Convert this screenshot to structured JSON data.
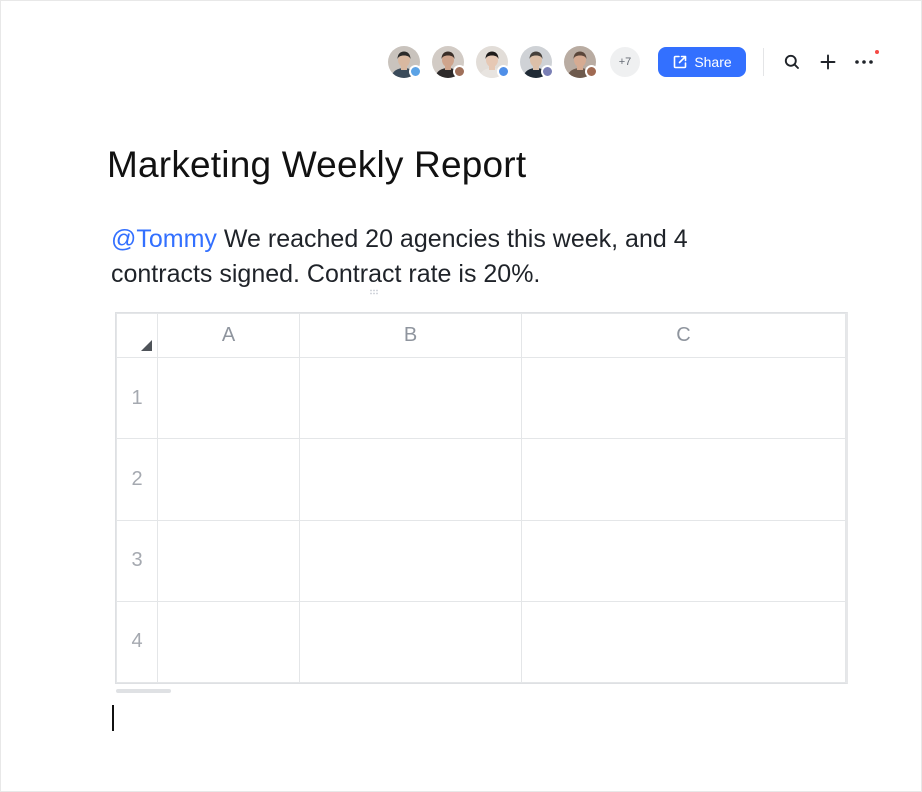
{
  "toolbar": {
    "collaborators": [
      {
        "name": "collaborator-1",
        "status_color": "#5ba3e6",
        "bg": "#c9c3bd",
        "hair": "#2a2a2a",
        "skin": "#d9b8a0",
        "shirt": "#3b4b5a"
      },
      {
        "name": "collaborator-2",
        "status_color": "#a0705a",
        "bg": "#d2cbc5",
        "hair": "#3a2e28",
        "skin": "#cfa48c",
        "shirt": "#2d2a2a"
      },
      {
        "name": "collaborator-3",
        "status_color": "#4f8fe8",
        "bg": "#e2ddd8",
        "hair": "#1e1b1a",
        "skin": "#e6c8b4",
        "shirt": "#e8e4e0"
      },
      {
        "name": "collaborator-4",
        "status_color": "#7a7fb5",
        "bg": "#cfd2d6",
        "hair": "#45403b",
        "skin": "#dcbfa8",
        "shirt": "#1f2a35"
      },
      {
        "name": "collaborator-5",
        "status_color": "#a06a52",
        "bg": "#b9aca2",
        "hair": "#5a463a",
        "skin": "#d6ab92",
        "shirt": "#6e5a4d"
      }
    ],
    "more_count": "+7",
    "share_label": "Share",
    "accent_color": "#3370ff",
    "icons": [
      "search-icon",
      "plus-icon",
      "more-icon"
    ]
  },
  "document": {
    "title": "Marketing Weekly Report",
    "mention": "@Tommy",
    "body_text": " We reached 20 agencies this week, and 4 contracts signed. Contract rate is 20%."
  },
  "sheet": {
    "columns": [
      "A",
      "B",
      "C"
    ],
    "rows": [
      {
        "label": "1",
        "cells": [
          "",
          "",
          ""
        ]
      },
      {
        "label": "2",
        "cells": [
          "",
          "",
          ""
        ]
      },
      {
        "label": "3",
        "cells": [
          "",
          "",
          ""
        ]
      },
      {
        "label": "4",
        "cells": [
          "",
          "",
          ""
        ]
      }
    ]
  }
}
